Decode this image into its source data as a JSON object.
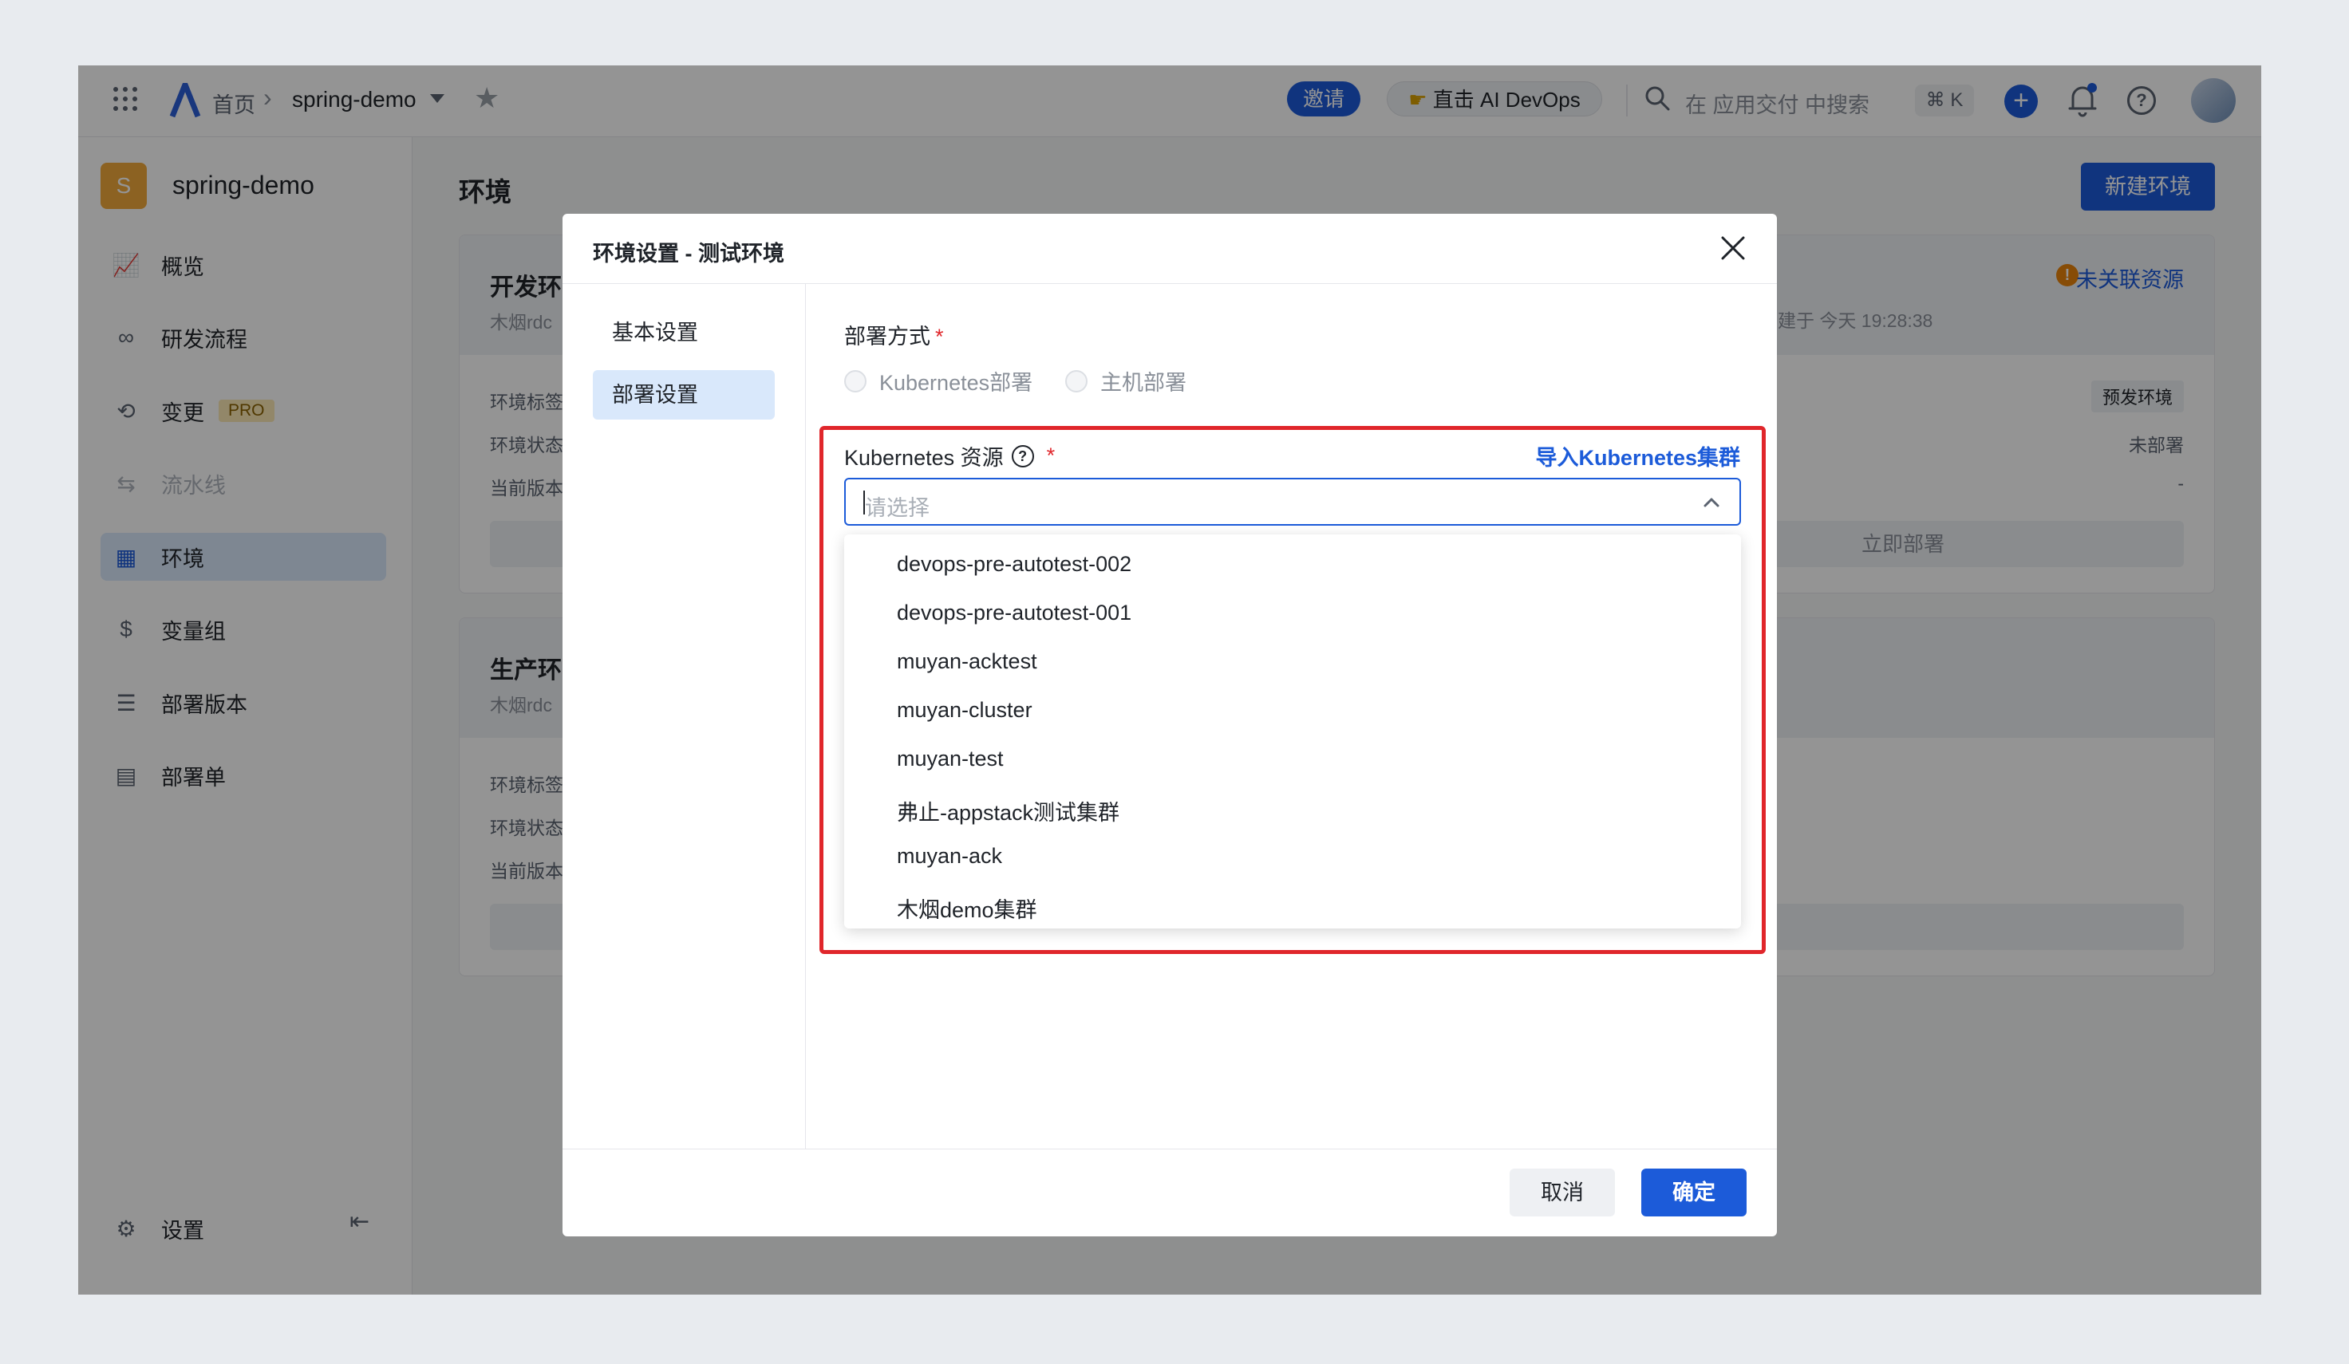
{
  "topbar": {
    "breadcrumb_home": "首页",
    "breadcrumb_sep": "›",
    "project_name": "spring-demo",
    "invite_label": "邀请",
    "ai_label": "直击 AI DevOps",
    "search_placeholder": "在 应用交付 中搜索",
    "shortcut": "⌘ K"
  },
  "sidebar": {
    "avatar_letter": "S",
    "app_name": "spring-demo",
    "items": [
      {
        "label": "概览"
      },
      {
        "label": "研发流程"
      },
      {
        "label": "变更",
        "badge": "PRO"
      },
      {
        "label": "流水线"
      },
      {
        "label": "环境"
      },
      {
        "label": "变量组"
      },
      {
        "label": "部署版本"
      },
      {
        "label": "部署单"
      }
    ],
    "settings_label": "设置"
  },
  "main": {
    "title": "环境",
    "new_env_button": "新建环境",
    "dev_card": {
      "title": "开发环",
      "owner": "木烟rdc",
      "unlinked": "未关联资源",
      "created": "建于 今天 19:28:38",
      "rows": [
        "环境标签",
        "环境状态",
        "当前版本"
      ],
      "tag": "预发环境",
      "status": "未部署",
      "version": "-",
      "deploy_button": "立即部署"
    },
    "prod_card": {
      "title": "生产环",
      "owner": "木烟rdc",
      "rows": [
        "环境标签",
        "环境状态",
        "当前版本"
      ]
    }
  },
  "modal": {
    "title": "环境设置 - 测试环境",
    "tabs": [
      "基本设置",
      "部署设置"
    ],
    "deploy_mode_label": "部署方式",
    "deploy_options": [
      "Kubernetes部署",
      "主机部署"
    ],
    "k8s_label": "Kubernetes 资源",
    "import_link": "导入Kubernetes集群",
    "select_placeholder": "请选择",
    "options": [
      "devops-pre-autotest-002",
      "devops-pre-autotest-001",
      "muyan-acktest",
      "muyan-cluster",
      "muyan-test",
      "弗止-appstack测试集群",
      "muyan-ack",
      "木烟demo集群"
    ],
    "cancel_label": "取消",
    "confirm_label": "确定"
  },
  "colors": {
    "primary": "#1c5bd9",
    "highlight_box": "#e0262b",
    "required": "#e0262b",
    "warning": "#e8830c"
  }
}
